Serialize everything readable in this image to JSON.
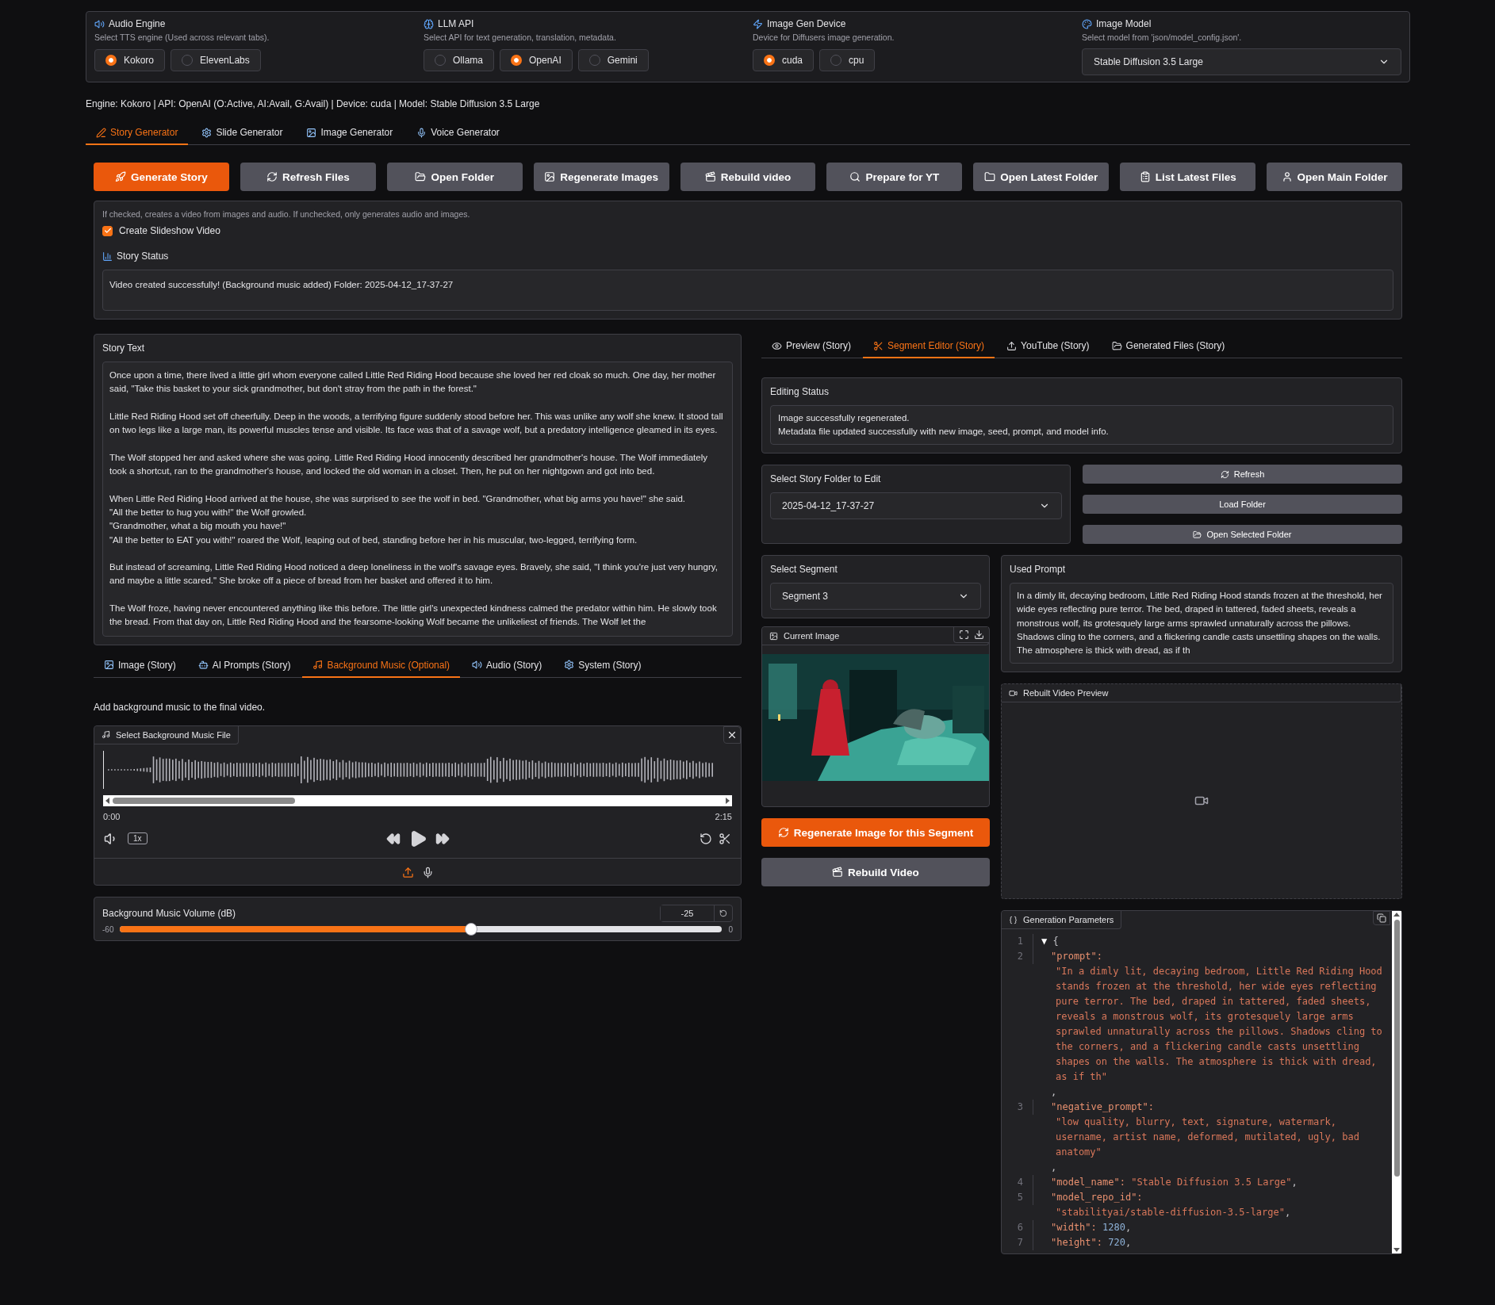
{
  "settings": [
    {
      "kind": "radio",
      "title": "Audio Engine",
      "info": "Select TTS engine (Used across relevant tabs).",
      "options": [
        {
          "label": "Kokoro",
          "selected": true
        },
        {
          "label": "ElevenLabs",
          "selected": false
        }
      ]
    },
    {
      "kind": "radio",
      "title": "LLM API",
      "info": "Select API for text generation, translation, metadata.",
      "options": [
        {
          "label": "Ollama",
          "selected": false
        },
        {
          "label": "OpenAI",
          "selected": true
        },
        {
          "label": "Gemini",
          "selected": false
        }
      ]
    },
    {
      "kind": "radio",
      "title": "Image Gen Device",
      "info": "Device for Diffusers image generation.",
      "options": [
        {
          "label": "cuda",
          "selected": true
        },
        {
          "label": "cpu",
          "selected": false
        }
      ]
    },
    {
      "kind": "dropdown",
      "title": "Image Model",
      "info": "Select model from 'json/model_config.json'.",
      "value": "Stable Diffusion 3.5 Large"
    }
  ],
  "status_line": "Engine: Kokoro | API: OpenAI (O:Active, AI:Avail, G:Avail) | Device: cuda | Model: Stable Diffusion 3.5 Large",
  "main_tabs": [
    {
      "label": "Story Generator",
      "selected": true
    },
    {
      "label": "Slide Generator",
      "selected": false
    },
    {
      "label": "Image Generator",
      "selected": false
    },
    {
      "label": "Voice Generator",
      "selected": false
    }
  ],
  "actions": [
    {
      "label": "Generate Story",
      "kind": "primary"
    },
    {
      "label": "Refresh Files",
      "kind": "secondary"
    },
    {
      "label": "Open Folder",
      "kind": "secondary"
    },
    {
      "label": "Regenerate Images",
      "kind": "secondary"
    },
    {
      "label": "Rebuild video",
      "kind": "secondary"
    },
    {
      "label": "Prepare for YT",
      "kind": "secondary"
    },
    {
      "label": "Open Latest Folder",
      "kind": "secondary"
    },
    {
      "label": "List Latest Files",
      "kind": "secondary"
    },
    {
      "label": "Open Main Folder",
      "kind": "secondary"
    }
  ],
  "slideshow": {
    "info": "If checked, creates a video from images and audio. If unchecked, only generates audio and images.",
    "label": "Create Slideshow Video",
    "checked": true
  },
  "story_status": {
    "label": "Story Status",
    "value": "Video created successfully! (Background music added) Folder: 2025-04-12_17-37-27"
  },
  "story_text": {
    "label": "Story Text",
    "value": "Once upon a time, there lived a little girl whom everyone called Little Red Riding Hood because she loved her red cloak so much. One day, her mother said, \"Take this basket to your sick grandmother, but don't stray from the path in the forest.\"\n\nLittle Red Riding Hood set off cheerfully. Deep in the woods, a terrifying figure suddenly stood before her. This was unlike any wolf she knew. It stood tall on two legs like a large man, its powerful muscles tense and visible. Its face was that of a savage wolf, but a predatory intelligence gleamed in its eyes.\n\nThe Wolf stopped her and asked where she was going. Little Red Riding Hood innocently described her grandmother's house. The Wolf immediately took a shortcut, ran to the grandmother's house, and locked the old woman in a closet. Then, he put on her nightgown and got into bed.\n\nWhen Little Red Riding Hood arrived at the house, she was surprised to see the wolf in bed. \"Grandmother, what big arms you have!\" she said.\n\"All the better to hug you with!\" the Wolf growled.\n\"Grandmother, what a big mouth you have!\"\n\"All the better to EAT you with!\" roared the Wolf, leaping out of bed, standing before her in his muscular, two-legged, terrifying form.\n\nBut instead of screaming, Little Red Riding Hood noticed a deep loneliness in the wolf's savage eyes. Bravely, she said, \"I think you're just very hungry, and maybe a little scared.\" She broke off a piece of bread from her basket and offered it to him.\n\nThe Wolf froze, having never encountered anything like this before. The little girl's unexpected kindness calmed the predator within him. He slowly took the bread. From that day on, Little Red Riding Hood and the fearsome-looking Wolf became the unlikeliest of friends. The Wolf let the"
  },
  "bottom_tabs": [
    {
      "label": "Image (Story)",
      "selected": false
    },
    {
      "label": "AI Prompts (Story)",
      "selected": false
    },
    {
      "label": "Background Music (Optional)",
      "selected": true
    },
    {
      "label": "Audio (Story)",
      "selected": false
    },
    {
      "label": "System (Story)",
      "selected": false
    }
  ],
  "background_music": {
    "description": "Add background music to the final video.",
    "file_label": "Select Background Music File",
    "time_start": "0:00",
    "time_end": "2:15",
    "speed": "1x",
    "volume": {
      "label": "Background Music Volume (dB)",
      "value": "-25",
      "min": "-60",
      "max": "0",
      "level": 0.583
    }
  },
  "editor_tabs": [
    {
      "label": "Preview (Story)",
      "selected": false
    },
    {
      "label": "Segment Editor (Story)",
      "selected": true
    },
    {
      "label": "YouTube (Story)",
      "selected": false
    },
    {
      "label": "Generated Files (Story)",
      "selected": false
    }
  ],
  "editing_status": {
    "label": "Editing Status",
    "lines": [
      "Image successfully regenerated.",
      "Metadata file updated successfully with new image, seed, prompt, and model info."
    ]
  },
  "folder_select": {
    "label": "Select Story Folder to Edit",
    "value": "2025-04-12_17-37-27"
  },
  "folder_buttons": [
    "Refresh",
    "Load Folder",
    "Open Selected Folder"
  ],
  "segment_select": {
    "label": "Select Segment",
    "value": "Segment 3"
  },
  "current_image": {
    "label": "Current Image",
    "kind": "picture"
  },
  "segment_buttons": [
    {
      "label": "Regenerate Image for this Segment",
      "kind": "primary"
    },
    {
      "label": "Rebuild Video",
      "kind": "secondary"
    }
  ],
  "used_prompt": {
    "label": "Used Prompt",
    "value": "In a dimly lit, decaying bedroom, Little Red Riding Hood stands frozen at the threshold, her wide eyes reflecting pure terror. The bed, draped in tattered, faded sheets, reveals a monstrous wolf, its grotesquely large arms sprawled unnaturally across the pillows. Shadows cling to the corners, and a flickering candle casts unsettling shapes on the walls. The atmosphere is thick with dread, as if th"
  },
  "video_preview": {
    "label": "Rebuilt Video Preview"
  },
  "generation_parameters": {
    "label": "Generation Parameters",
    "first_number": "1",
    "toggle": "▼",
    "open": "{",
    "lines": [
      {
        "number": "2",
        "key": "\"prompt\":",
        "value": "\"In a dimly lit, decaying bedroom, Little Red Riding Hood stands frozen at the threshold, her wide eyes reflecting pure terror. The bed, draped in tattered, faded sheets, reveals a monstrous wolf, its grotesquely large arms sprawled unnaturally across the pillows. Shadows cling to the corners, and a flickering candle casts unsettling shapes on the walls. The atmosphere is thick with dread, as if th\"",
        "kind": "string",
        "break": true,
        "comma": ",",
        "comma_break": true
      },
      {
        "number": "3",
        "key": "\"negative_prompt\":",
        "value": "\"low quality, blurry, text, signature, watermark, username, artist name, deformed, mutilated, ugly, bad anatomy\"",
        "kind": "string",
        "break": true,
        "comma": ",",
        "comma_break": true
      },
      {
        "number": "4",
        "key": "\"model_name\":",
        "value": "\"Stable Diffusion 3.5 Large\"",
        "kind": "string",
        "break": false,
        "comma": ",",
        "comma_break": false
      },
      {
        "number": "5",
        "key": "\"model_repo_id\":",
        "value": "\"stabilityai/stable-diffusion-3.5-large\"",
        "kind": "string",
        "break": true,
        "comma": ",",
        "comma_break": false
      },
      {
        "number": "6",
        "key": "\"width\":",
        "value": "1280",
        "kind": "number",
        "break": false,
        "comma": ",",
        "comma_break": false
      },
      {
        "number": "7",
        "key": "\"height\":",
        "value": "720",
        "kind": "number",
        "break": false,
        "comma": ",",
        "comma_break": false
      }
    ]
  }
}
